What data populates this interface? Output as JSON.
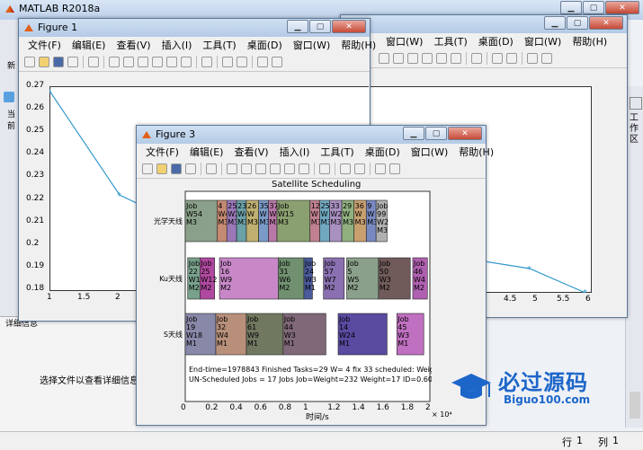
{
  "matlab": {
    "title": "MATLAB R2018a",
    "left_strip": {
      "t1": "新",
      "t2": "当前",
      "panel_label": "详细信息",
      "detail_msg": "选择文件以查看详细信息"
    },
    "right_side_label": "工作区",
    "status": {
      "row_label": "行",
      "row": "1",
      "col_label": "列",
      "col": "1"
    },
    "partial_top": "APP"
  },
  "menus": [
    "文件(F)",
    "编辑(E)",
    "查看(V)",
    "插入(I)",
    "工具(T)",
    "桌面(D)",
    "窗口(W)",
    "帮助(H)"
  ],
  "fig1": {
    "title": "Figure 1",
    "y_ticks": [
      "0.27",
      "0.26",
      "0.25",
      "0.24",
      "0.23",
      "0.22",
      "0.21",
      "0.2",
      "0.19",
      "0.18"
    ],
    "x_ticks_left": [
      "1",
      "1.5",
      "2"
    ],
    "x_ticks_right": [
      "4.5",
      "5",
      "5.5",
      "6"
    ]
  },
  "fig3": {
    "title": "Figure 3",
    "chart_title": "Satellite Scheduling",
    "xlabel": "时间/s",
    "x_exp": "× 10⁴",
    "x_ticks": [
      "0",
      "0.2",
      "0.4",
      "0.6",
      "0.8",
      "1",
      "1.2",
      "1.4",
      "1.6",
      "1.8",
      "2"
    ],
    "y_rows": [
      "光学天线",
      "Ku天线",
      "S天线"
    ],
    "bottom_text1": "End-time=1978843 Finished Tasks=29 W= 4 fix 33 scheduled: Weight=0.22,1.56,0.58,5.15",
    "bottom_text2": "UN-Scheduled Jobs = 17 Jobs Job=Weight=232 Weight=17 ID=0.60 3.5,7.22 0.9 5.42"
  },
  "chart_data": {
    "type": "line",
    "title": "",
    "x": [
      1,
      2,
      5,
      6
    ],
    "values": [
      0.268,
      0.229,
      0.197,
      0.185
    ],
    "ylim": [
      0.18,
      0.27
    ],
    "xlim": [
      1,
      6
    ],
    "color": "#3399cc"
  },
  "gantt": {
    "xlim": [
      0,
      20000
    ],
    "rows": [
      {
        "name": "光学天线",
        "blocks": [
          {
            "start": 0,
            "end": 2600,
            "color": "#8aa08a",
            "lines": [
              "Job",
              "W54",
              "M3"
            ]
          },
          {
            "start": 2600,
            "end": 3400,
            "color": "#c48a72",
            "lines": [
              "4",
              "W4",
              "M3"
            ]
          },
          {
            "start": 3400,
            "end": 4200,
            "color": "#9a78b8",
            "lines": [
              "25",
              "W2",
              "M3"
            ]
          },
          {
            "start": 4200,
            "end": 5000,
            "color": "#6aa0a8",
            "lines": [
              "23",
              "W4",
              "M3"
            ]
          },
          {
            "start": 5000,
            "end": 6000,
            "color": "#c0b070",
            "lines": [
              "26",
              "W",
              "M3"
            ]
          },
          {
            "start": 6000,
            "end": 6800,
            "color": "#7a9ac8",
            "lines": [
              "35",
              "W",
              "M3"
            ]
          },
          {
            "start": 6800,
            "end": 7500,
            "color": "#b878a8",
            "lines": [
              "37",
              "W",
              "M3"
            ]
          },
          {
            "start": 7500,
            "end": 10200,
            "color": "#8aa070",
            "lines": [
              "Job",
              "W15",
              "M3"
            ]
          },
          {
            "start": 10200,
            "end": 11000,
            "color": "#c08090",
            "lines": [
              "12",
              "W",
              "M3"
            ]
          },
          {
            "start": 11000,
            "end": 11800,
            "color": "#70a8c0",
            "lines": [
              "25",
              "W",
              "M3"
            ]
          },
          {
            "start": 11800,
            "end": 12800,
            "color": "#a890c0",
            "lines": [
              "33",
              "W2",
              "M3"
            ]
          },
          {
            "start": 12800,
            "end": 13800,
            "color": "#90b080",
            "lines": [
              "29",
              "W",
              "M3"
            ]
          },
          {
            "start": 13800,
            "end": 14800,
            "color": "#c8a070",
            "lines": [
              "36",
              "W",
              "M3"
            ]
          },
          {
            "start": 14800,
            "end": 15600,
            "color": "#7888c0",
            "lines": [
              "9",
              "W",
              "M3"
            ]
          },
          {
            "start": 15600,
            "end": 16500,
            "color": "#b0b0b0",
            "lines": [
              "Job",
              "99",
              "W2",
              "M3"
            ]
          }
        ]
      },
      {
        "name": "Ku天线",
        "blocks": [
          {
            "start": 200,
            "end": 1200,
            "color": "#78a08a",
            "lines": [
              "Job",
              "22",
              "W1",
              "M2"
            ]
          },
          {
            "start": 1200,
            "end": 2400,
            "color": "#b048a0",
            "lines": [
              "Job",
              "25",
              "W12",
              "M2"
            ]
          },
          {
            "start": 2800,
            "end": 7600,
            "color": "#c888c8",
            "lines": [
              "Job",
              "16",
              "W9",
              "M2"
            ]
          },
          {
            "start": 7600,
            "end": 9700,
            "color": "#709070",
            "lines": [
              "Job",
              "31",
              "W6",
              "M2"
            ]
          },
          {
            "start": 9700,
            "end": 10400,
            "color": "#4a5a9a",
            "lines": [
              "Job",
              "24",
              "W3",
              "M1"
            ]
          },
          {
            "start": 11300,
            "end": 13000,
            "color": "#8a70b0",
            "lines": [
              "Job",
              "57",
              "W7",
              "M2"
            ]
          },
          {
            "start": 13200,
            "end": 15800,
            "color": "#8aa08a",
            "lines": [
              "Job",
              "5",
              "W5",
              "M2"
            ]
          },
          {
            "start": 15800,
            "end": 18400,
            "color": "#705a5a",
            "lines": [
              "Job",
              "50",
              "W3",
              "M2"
            ]
          },
          {
            "start": 18600,
            "end": 19800,
            "color": "#b060b0",
            "lines": [
              "Job",
              "46",
              "W4",
              "M2"
            ]
          }
        ]
      },
      {
        "name": "S天线",
        "blocks": [
          {
            "start": 0,
            "end": 2500,
            "color": "#8888a8",
            "lines": [
              "Job",
              "19",
              "W18",
              "M1"
            ]
          },
          {
            "start": 2500,
            "end": 5000,
            "color": "#b8907a",
            "lines": [
              "Job",
              "32",
              "W4",
              "M1"
            ]
          },
          {
            "start": 5000,
            "end": 8000,
            "color": "#707860",
            "lines": [
              "Job",
              "61",
              "W9",
              "M1"
            ]
          },
          {
            "start": 8000,
            "end": 11500,
            "color": "#806878",
            "lines": [
              "Job",
              "44",
              "W3",
              "M1"
            ]
          },
          {
            "start": 12500,
            "end": 16500,
            "color": "#5a4aa0",
            "lines": [
              "Job",
              "14",
              "W24",
              "M1"
            ]
          },
          {
            "start": 17300,
            "end": 19500,
            "color": "#c070c0",
            "lines": [
              "Job",
              "45",
              "W3",
              "M1"
            ]
          }
        ]
      }
    ]
  },
  "watermark": {
    "main": "必过源码",
    "sub": "Biguo100.com"
  }
}
